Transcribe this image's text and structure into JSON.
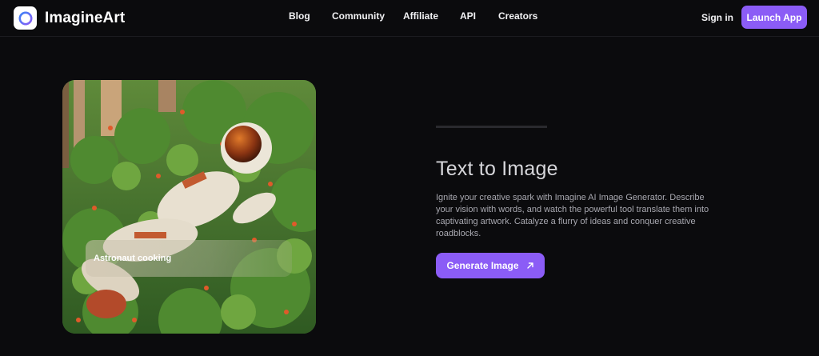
{
  "brand": {
    "name": "ImagineArt",
    "accent": "#8b5cf6"
  },
  "nav": {
    "links": [
      "Blog",
      "Community",
      "Affiliate",
      "API",
      "Creators"
    ],
    "signin_label": "Sign in",
    "launch_label": "Launch App"
  },
  "hero": {
    "image_caption": "Astronaut cooking",
    "title": "Text to Image",
    "description": "Ignite your creative spark with Imagine AI Image Generator. Describe your vision with words, and watch the powerful tool translate them into captivating artwork. Catalyze a flurry of ideas and conquer creative roadblocks.",
    "cta_label": "Generate Image",
    "cta_icon": "arrow-up-right-icon"
  }
}
